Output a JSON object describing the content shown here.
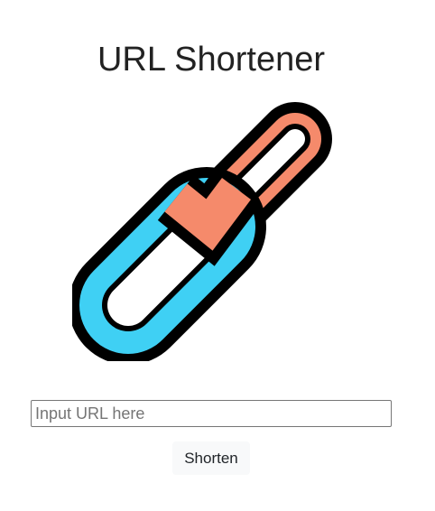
{
  "page": {
    "title": "URL Shortener"
  },
  "logo": {
    "icon": "chain-link-icon",
    "colors": {
      "front_link": "#f58a6b",
      "back_link": "#3fd0f4",
      "outline": "#000000"
    }
  },
  "form": {
    "url_input": {
      "placeholder": "Input URL here",
      "value": ""
    },
    "submit_label": "Shorten"
  }
}
